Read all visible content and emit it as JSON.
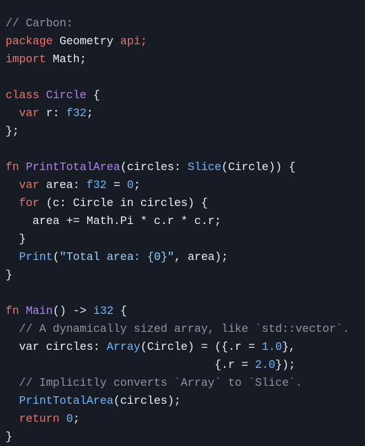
{
  "editor": {
    "language": "carbon",
    "background": "#171b24",
    "font_size_px": 16.5,
    "line_height_px": 26,
    "palette": {
      "background": "#171b24",
      "plain": "#e6edf3",
      "comment": "#8b949e",
      "keyword": "#f47067",
      "entity": "#b083f0",
      "type": "#6cb6ff",
      "number": "#6cb6ff",
      "call": "#6cb6ff",
      "string": "#96d0ff"
    },
    "plain_text": "// Carbon:\npackage Geometry api;\nimport Math;\n\nclass Circle {\n  var r: f32;\n};\n\nfn PrintTotalArea(circles: Slice(Circle)) {\n  var area: f32 = 0;\n  for (c: Circle in circles) {\n    area += Math.Pi * c.r * c.r;\n  }\n  Print(\"Total area: {0}\", area);\n}\n\nfn Main() -> i32 {\n  // A dynamically sized array, like `std::vector`.\n  var circles: Array(Circle) = ({.r = 1.0},\n                               {.r = 2.0});\n  // Implicitly converts `Array` to `Slice`.\n  PrintTotalArea(circles);\n  return 0;\n}",
    "lines": [
      {
        "n": 1,
        "tokens": [
          {
            "t": "// Carbon:",
            "c": "comment"
          }
        ]
      },
      {
        "n": 2,
        "tokens": [
          {
            "t": "package",
            "c": "keyword"
          },
          {
            "t": " ",
            "c": "plain"
          },
          {
            "t": "Geometry",
            "c": "plain"
          },
          {
            "t": " ",
            "c": "plain"
          },
          {
            "t": "api;",
            "c": "keyword"
          }
        ]
      },
      {
        "n": 3,
        "tokens": [
          {
            "t": "import",
            "c": "keyword"
          },
          {
            "t": " ",
            "c": "plain"
          },
          {
            "t": "Math;",
            "c": "plain"
          }
        ]
      },
      {
        "n": 4,
        "tokens": []
      },
      {
        "n": 5,
        "tokens": [
          {
            "t": "class",
            "c": "keyword"
          },
          {
            "t": " ",
            "c": "plain"
          },
          {
            "t": "Circle",
            "c": "entity"
          },
          {
            "t": " {",
            "c": "plain"
          }
        ]
      },
      {
        "n": 6,
        "tokens": [
          {
            "t": "  ",
            "c": "plain"
          },
          {
            "t": "var",
            "c": "keyword"
          },
          {
            "t": " r: ",
            "c": "plain"
          },
          {
            "t": "f32",
            "c": "type"
          },
          {
            "t": ";",
            "c": "plain"
          }
        ]
      },
      {
        "n": 7,
        "tokens": [
          {
            "t": "};",
            "c": "plain"
          }
        ]
      },
      {
        "n": 8,
        "tokens": []
      },
      {
        "n": 9,
        "tokens": [
          {
            "t": "fn",
            "c": "keyword"
          },
          {
            "t": " ",
            "c": "plain"
          },
          {
            "t": "PrintTotalArea",
            "c": "entity"
          },
          {
            "t": "(circles: ",
            "c": "plain"
          },
          {
            "t": "Slice",
            "c": "type"
          },
          {
            "t": "(Circle)) {",
            "c": "plain"
          }
        ]
      },
      {
        "n": 10,
        "tokens": [
          {
            "t": "  ",
            "c": "plain"
          },
          {
            "t": "var",
            "c": "keyword"
          },
          {
            "t": " area: ",
            "c": "plain"
          },
          {
            "t": "f32",
            "c": "type"
          },
          {
            "t": " = ",
            "c": "plain"
          },
          {
            "t": "0",
            "c": "number"
          },
          {
            "t": ";",
            "c": "plain"
          }
        ]
      },
      {
        "n": 11,
        "tokens": [
          {
            "t": "  ",
            "c": "plain"
          },
          {
            "t": "for",
            "c": "keyword"
          },
          {
            "t": " (c: Circle in circles) {",
            "c": "plain"
          }
        ]
      },
      {
        "n": 12,
        "tokens": [
          {
            "t": "    area += Math.Pi * c.r * c.r;",
            "c": "plain"
          }
        ]
      },
      {
        "n": 13,
        "tokens": [
          {
            "t": "  }",
            "c": "plain"
          }
        ]
      },
      {
        "n": 14,
        "tokens": [
          {
            "t": "  ",
            "c": "plain"
          },
          {
            "t": "Print",
            "c": "call"
          },
          {
            "t": "(",
            "c": "plain"
          },
          {
            "t": "\"Total area: {0}\"",
            "c": "string"
          },
          {
            "t": ", area);",
            "c": "plain"
          }
        ]
      },
      {
        "n": 15,
        "tokens": [
          {
            "t": "}",
            "c": "plain"
          }
        ]
      },
      {
        "n": 16,
        "tokens": []
      },
      {
        "n": 17,
        "tokens": [
          {
            "t": "fn",
            "c": "keyword"
          },
          {
            "t": " ",
            "c": "plain"
          },
          {
            "t": "Main",
            "c": "entity"
          },
          {
            "t": "() -> ",
            "c": "plain"
          },
          {
            "t": "i32",
            "c": "type"
          },
          {
            "t": " {",
            "c": "plain"
          }
        ]
      },
      {
        "n": 18,
        "tokens": [
          {
            "t": "  ",
            "c": "plain"
          },
          {
            "t": "// A dynamically sized array, like `std::vector`.",
            "c": "comment"
          }
        ]
      },
      {
        "n": 19,
        "tokens": [
          {
            "t": "  var circles: ",
            "c": "plain"
          },
          {
            "t": "Array",
            "c": "type"
          },
          {
            "t": "(Circle) = ({.r = ",
            "c": "plain"
          },
          {
            "t": "1.0",
            "c": "number"
          },
          {
            "t": "},",
            "c": "plain"
          }
        ]
      },
      {
        "n": 20,
        "tokens": [
          {
            "t": "                               {.r = ",
            "c": "plain"
          },
          {
            "t": "2.0",
            "c": "number"
          },
          {
            "t": "});",
            "c": "plain"
          }
        ]
      },
      {
        "n": 21,
        "tokens": [
          {
            "t": "  ",
            "c": "plain"
          },
          {
            "t": "// Implicitly converts `Array` to `Slice`.",
            "c": "comment"
          }
        ]
      },
      {
        "n": 22,
        "tokens": [
          {
            "t": "  ",
            "c": "plain"
          },
          {
            "t": "PrintTotalArea",
            "c": "call"
          },
          {
            "t": "(circles);",
            "c": "plain"
          }
        ]
      },
      {
        "n": 23,
        "tokens": [
          {
            "t": "  ",
            "c": "plain"
          },
          {
            "t": "return",
            "c": "keyword"
          },
          {
            "t": " ",
            "c": "plain"
          },
          {
            "t": "0",
            "c": "number"
          },
          {
            "t": ";",
            "c": "plain"
          }
        ]
      },
      {
        "n": 24,
        "tokens": [
          {
            "t": "}",
            "c": "plain"
          }
        ]
      }
    ]
  }
}
